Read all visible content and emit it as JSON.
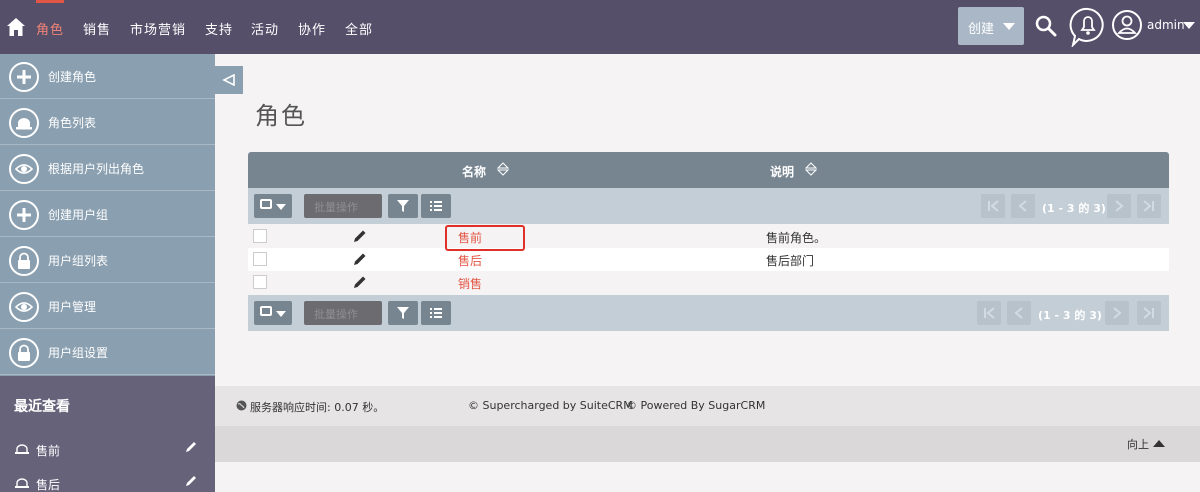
{
  "nav": {
    "items": [
      "角色",
      "销售",
      "市场营销",
      "支持",
      "活动",
      "协作",
      "全部"
    ],
    "create_label": "创建",
    "user_label": "admin"
  },
  "sidebar": {
    "items": [
      {
        "label": "创建角色",
        "icon": "plus-icon"
      },
      {
        "label": "角色列表",
        "icon": "roles-icon"
      },
      {
        "label": "根据用户列出角色",
        "icon": "eye-icon"
      },
      {
        "label": "创建用户组",
        "icon": "plus-icon"
      },
      {
        "label": "用户组列表",
        "icon": "lock-icon"
      },
      {
        "label": "用户管理",
        "icon": "eye-icon"
      },
      {
        "label": "用户组设置",
        "icon": "lock-icon"
      }
    ],
    "recent_title": "最近查看",
    "recent_items": [
      "售前",
      "售后"
    ]
  },
  "main": {
    "title": "角色",
    "columns": [
      "名称",
      "说明"
    ],
    "bulk_label": "批量操作",
    "pagination_text": "(1 - 3 的 3)",
    "rows": [
      {
        "name": "售前",
        "desc": "售前角色。"
      },
      {
        "name": "售后",
        "desc": "售后部门"
      },
      {
        "name": "销售",
        "desc": ""
      }
    ]
  },
  "footer": {
    "response_time": "服务器响应时间: 0.07 秒。",
    "supercharged": "© Supercharged by SuiteCRM",
    "powered": "© Powered By SugarCRM",
    "back_to_top": "向上"
  },
  "colors": {
    "topbar": "#554f6a",
    "accent": "#e25646",
    "sidebar": "#8a9fb0",
    "table_header": "#778591"
  }
}
